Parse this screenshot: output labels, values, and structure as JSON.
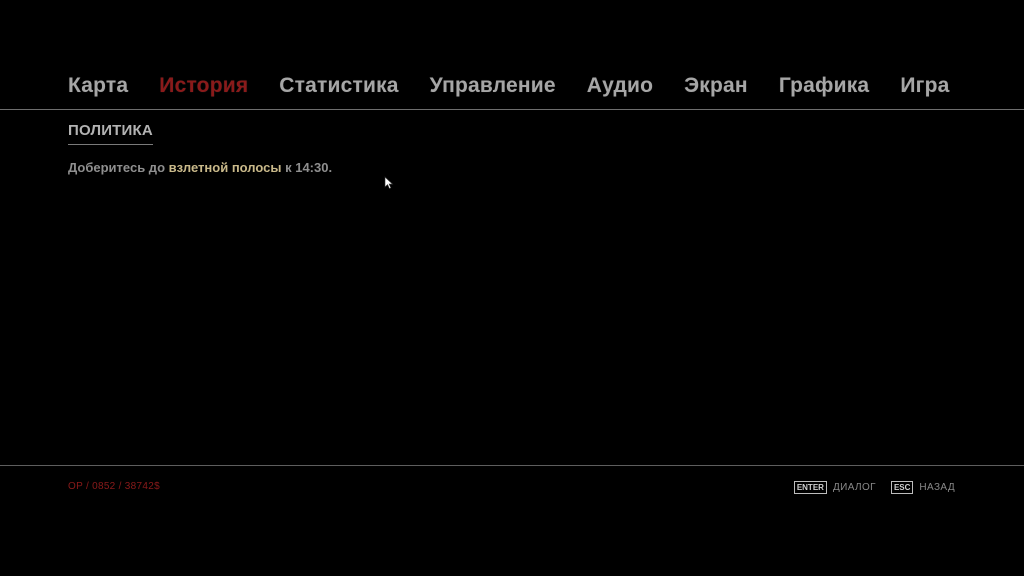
{
  "nav": {
    "tabs": [
      {
        "label": "Карта"
      },
      {
        "label": "История"
      },
      {
        "label": "Статистика"
      },
      {
        "label": "Управление"
      },
      {
        "label": "Аудио"
      },
      {
        "label": "Экран"
      },
      {
        "label": "Графика"
      },
      {
        "label": "Игра"
      }
    ],
    "active_index": 1
  },
  "section": {
    "title": "ПОЛИТИКА",
    "objective": {
      "prefix": "Доберитесь до ",
      "highlight": "взлетной полосы",
      "suffix": " к 14:30."
    }
  },
  "footer": {
    "stats": "OP / 0852 / 38742$",
    "hints": [
      {
        "key": "ENTER",
        "label": "ДИАЛОГ"
      },
      {
        "key": "ESC",
        "label": "НАЗАД"
      }
    ]
  },
  "colors": {
    "background": "#000000",
    "tab_active": "#8a1a1a",
    "tab_inactive": "#a6a6a6",
    "highlight": "#c9b98a",
    "stats": "#8a1a1a"
  },
  "icons": {
    "cursor": "mouse-pointer-icon"
  }
}
